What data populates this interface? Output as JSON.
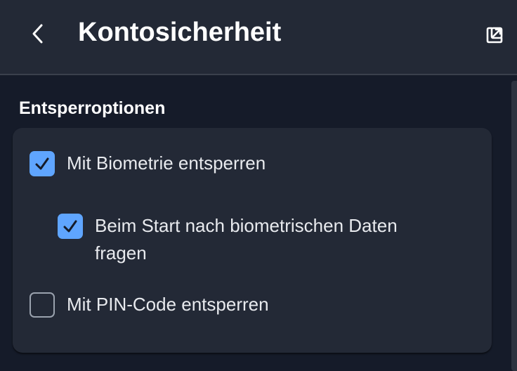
{
  "header": {
    "title": "Kontosicherheit",
    "back_icon": "chevron-left-icon",
    "popout_icon": "pop-out-icon"
  },
  "section": {
    "title": "Entsperroptionen"
  },
  "options": [
    {
      "label": "Mit Biometrie entsperren",
      "checked": true
    },
    {
      "label": "Beim Start nach biometrischen Daten fragen",
      "checked": true
    },
    {
      "label": "Mit PIN-Code entsperren",
      "checked": false
    }
  ],
  "colors": {
    "background": "#151b29",
    "surface": "#232936",
    "accent": "#5fa5ff",
    "text": "#ffffff"
  }
}
